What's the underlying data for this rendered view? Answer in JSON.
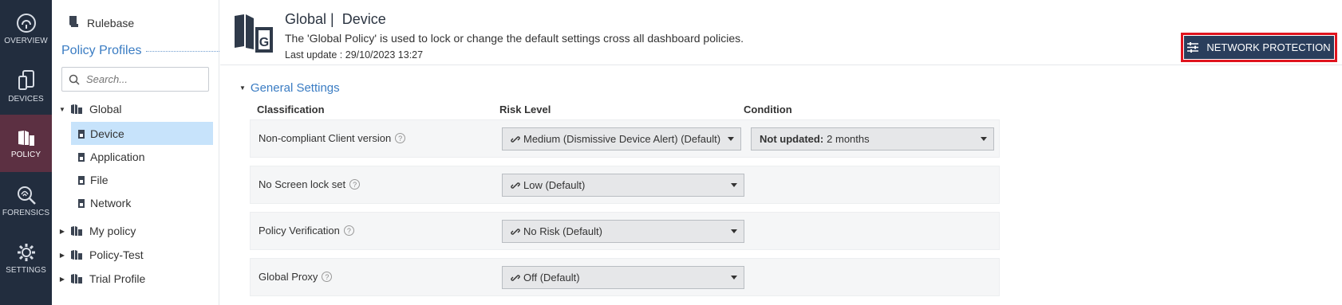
{
  "nav": {
    "overview": "OVERVIEW",
    "devices": "DEVICES",
    "policy": "POLICY",
    "forensics": "FORENSICS",
    "settings": "SETTINGS"
  },
  "tree": {
    "rulebase": "Rulebase",
    "profiles_title": "Policy Profiles",
    "search_placeholder": "Search...",
    "global": "Global",
    "children": {
      "device": "Device",
      "application": "Application",
      "file": "File",
      "network": "Network"
    },
    "my_policy": "My policy",
    "policy_test": "Policy-Test",
    "trial_profile": "Trial Profile"
  },
  "header": {
    "title_prefix": "Global |",
    "title_page": "Device",
    "description": "The 'Global Policy' is used to lock or change the default settings cross all dashboard policies.",
    "last_update": "Last update : 29/10/2023 13:27",
    "network_protection_label": "NETWORK PROTECTION"
  },
  "settings": {
    "section_title": "General Settings",
    "columns": {
      "classification": "Classification",
      "risk_level": "Risk Level",
      "condition": "Condition"
    },
    "rows": [
      {
        "label": "Non-compliant Client version",
        "risk": "Medium (Dismissive Device Alert) (Default)",
        "condition_key": "Not updated:",
        "condition_value": "2 months"
      },
      {
        "label": "No Screen lock set",
        "risk": "Low (Default)"
      },
      {
        "label": "Policy Verification",
        "risk": "No Risk (Default)"
      },
      {
        "label": "Global Proxy",
        "risk": "Off (Default)"
      }
    ]
  },
  "colors": {
    "rail_bg": "#222d3e",
    "rail_active": "#5c3042",
    "accent_blue": "#3a7cc3",
    "selected_row": "#c7e3fb",
    "np_button": "#2a3e5c",
    "highlight_outline": "#e0141e"
  }
}
